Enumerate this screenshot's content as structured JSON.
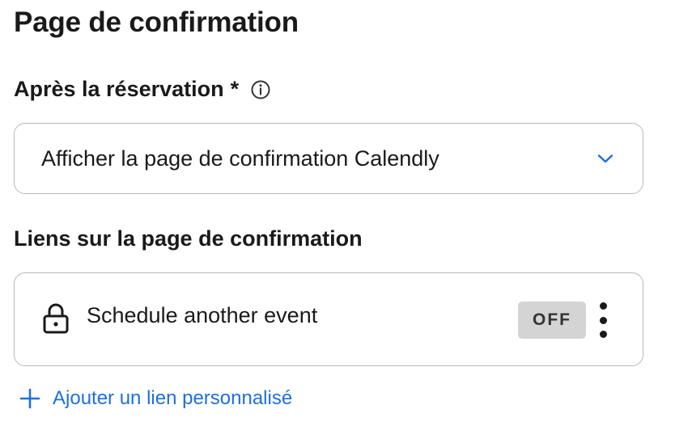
{
  "page": {
    "title": "Page de confirmation"
  },
  "after_booking": {
    "label": "Après la réservation",
    "required_marker": "*",
    "info_icon": "info-circle-icon",
    "select_value": "Afficher la page de confirmation Calendly",
    "chevron_icon": "chevron-down-icon"
  },
  "links": {
    "label": "Liens sur la page de confirmation",
    "items": [
      {
        "icon": "lock-icon",
        "label": "Schedule another event",
        "toggle": "OFF",
        "menu_icon": "kebab-menu-icon"
      }
    ],
    "add_label": "Ajouter un lien personnalisé",
    "add_icon": "plus-icon"
  },
  "colors": {
    "accent": "#1f6fe0",
    "text": "#1a1a1a",
    "border": "#b9b9b9",
    "toggle_off_bg": "#d4d4d4"
  }
}
